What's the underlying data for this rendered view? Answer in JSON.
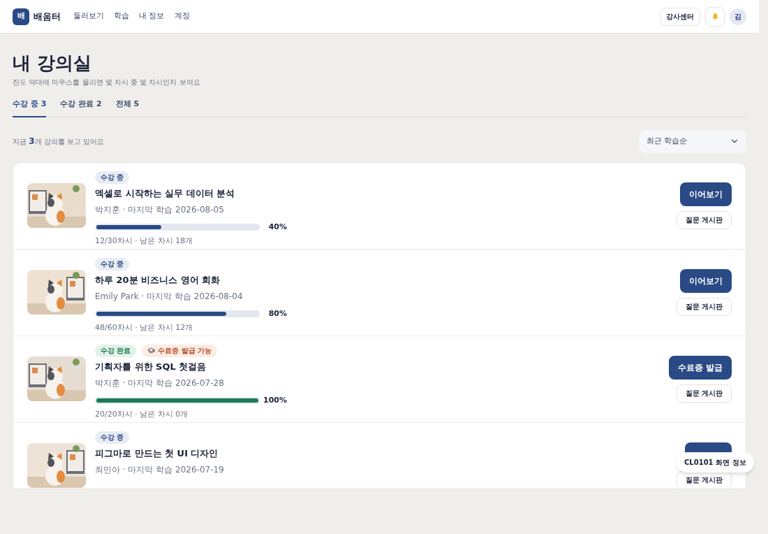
{
  "header": {
    "logo_mark": "배",
    "brand": "배움터",
    "nav": [
      "둘러보기",
      "학습",
      "내 정보",
      "계정"
    ],
    "instructor_button": "강사센터",
    "avatar": "김"
  },
  "page": {
    "title": "내 강의실",
    "subtitle": "진도 막대에 마우스를 올리면 몇 차시 중 몇 차시인지 보여요"
  },
  "tabs": [
    {
      "label": "수강 중 3",
      "selected": true
    },
    {
      "label": "수강 완료 2",
      "selected": false
    },
    {
      "label": "전체 5",
      "selected": false
    }
  ],
  "summary": "지금 **3**개 강의를 보고 있어요",
  "sort": {
    "value": "최근 학습순"
  },
  "courses": [
    {
      "badges": [
        {
          "kind": "in_progress",
          "label": "수강 중"
        }
      ],
      "title": "엑셀로 시작하는 실무 데이터 분석",
      "meta": "박지훈 · 마지막 학습 2026-08-05",
      "level": 0.4,
      "percent": "40%",
      "sessions": "12/30차시 · 남은 차시 18개",
      "primary": "이어보기",
      "secondary": "질문 게시판"
    },
    {
      "badges": [
        {
          "kind": "in_progress",
          "label": "수강 중"
        }
      ],
      "title": "하루 20분 비즈니스 영어 회화",
      "meta": "Emily Park · 마지막 학습 2026-08-04",
      "level": 0.8,
      "percent": "80%",
      "sessions": "48/60차시 · 남은 차시 12개",
      "primary": "이어보기",
      "secondary": "질문 게시판"
    },
    {
      "badges": [
        {
          "kind": "completed",
          "label": "수강 완료"
        },
        {
          "kind": "certificate",
          "label": "수료증 발급 가능"
        }
      ],
      "title": "기획자를 위한 SQL 첫걸음",
      "meta": "박지훈 · 마지막 학습 2026-07-28",
      "level": 1,
      "percent": "100%",
      "sessions": "20/20차시 · 남은 차시 0개",
      "primary": "수료증 발급",
      "secondary": "질문 게시판"
    },
    {
      "badges": [
        {
          "kind": "in_progress",
          "label": "수강 중"
        }
      ],
      "title": "피그마로 만드는 첫 UI 디자인",
      "meta": "최민아 · 마지막 학습 2026-07-19",
      "secondary": "질문 게시판"
    }
  ],
  "screen_info": "CL0101 화면 정보"
}
